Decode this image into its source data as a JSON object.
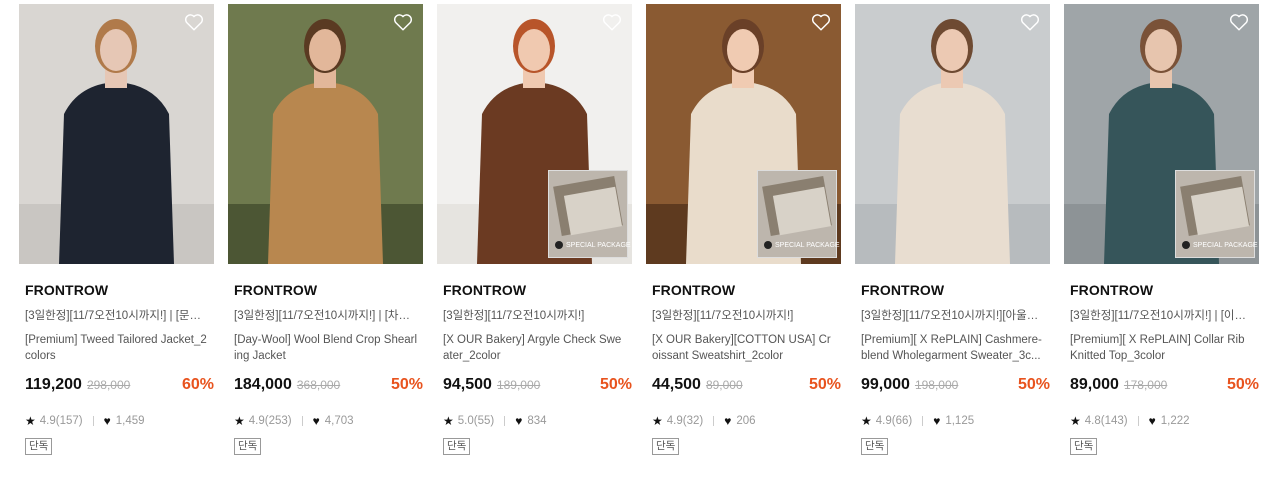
{
  "colors": {
    "discount": "#e8531e",
    "text": "#111111",
    "muted": "#999999"
  },
  "products": [
    {
      "brand": "FRONTROW",
      "promo": "[3일한정][11/7오전10시까지!] | [문정...",
      "name": "[Premium] Tweed Tailored Jacket_2colors",
      "price": "119,200",
      "original_price": "298,000",
      "discount": "60%",
      "rating": "4.9(157)",
      "likes": "1,459",
      "tag": "단독",
      "special_package": false,
      "package_label": ""
    },
    {
      "brand": "FRONTROW",
      "promo": "[3일한정][11/7오전10시까지!] | [차정...",
      "name": "[Day-Wool] Wool Blend Crop Shearling Jacket",
      "price": "184,000",
      "original_price": "368,000",
      "discount": "50%",
      "rating": "4.9(253)",
      "likes": "4,703",
      "tag": "단독",
      "special_package": false,
      "package_label": ""
    },
    {
      "brand": "FRONTROW",
      "promo": "[3일한정][11/7오전10시까지!]",
      "name": "[X OUR Bakery] Argyle Check Sweater_2color",
      "price": "94,500",
      "original_price": "189,000",
      "discount": "50%",
      "rating": "5.0(55)",
      "likes": "834",
      "tag": "단독",
      "special_package": true,
      "package_label": "SPECIAL PACKAGE"
    },
    {
      "brand": "FRONTROW",
      "promo": "[3일한정][11/7오전10시까지!]",
      "name": "[X OUR Bakery][COTTON USA] Croissant Sweatshirt_2color",
      "price": "44,500",
      "original_price": "89,000",
      "discount": "50%",
      "rating": "4.9(32)",
      "likes": "206",
      "tag": "단독",
      "special_package": true,
      "package_label": "SPECIAL PACKAGE"
    },
    {
      "brand": "FRONTROW",
      "promo": "[3일한정][11/7오전10시까지!][아울렛...",
      "name": "[Premium][ X RePLAIN] Cashmere-blend Wholegarment Sweater_3c...",
      "price": "99,000",
      "original_price": "198,000",
      "discount": "50%",
      "rating": "4.9(66)",
      "likes": "1,125",
      "tag": "단독",
      "special_package": false,
      "package_label": ""
    },
    {
      "brand": "FRONTROW",
      "promo": "[3일한정][11/7오전10시까지!] | [이성...",
      "name": "[Premium][ X RePLAIN] Collar Rib Knitted Top_3color",
      "price": "89,000",
      "original_price": "178,000",
      "discount": "50%",
      "rating": "4.8(143)",
      "likes": "1,222",
      "tag": "단독",
      "special_package": true,
      "package_label": "SPECIAL PACKAGE"
    }
  ]
}
